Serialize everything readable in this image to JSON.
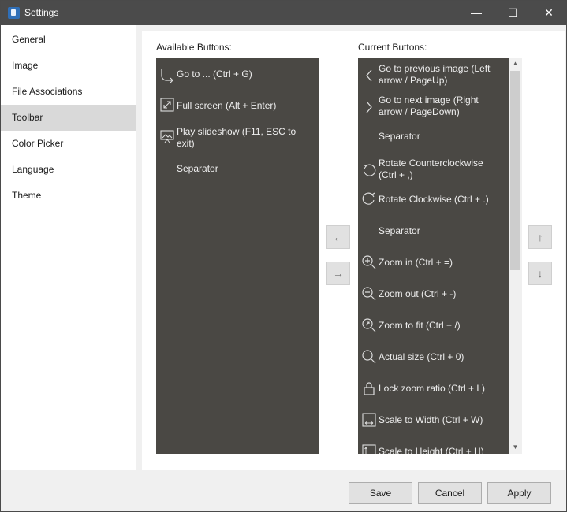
{
  "window": {
    "title": "Settings"
  },
  "titlebar": {
    "minimize": "—",
    "maximize": "☐",
    "close": "✕"
  },
  "sidebar": {
    "items": [
      {
        "label": "General"
      },
      {
        "label": "Image"
      },
      {
        "label": "File Associations"
      },
      {
        "label": "Toolbar",
        "active": true
      },
      {
        "label": "Color Picker"
      },
      {
        "label": "Language"
      },
      {
        "label": "Theme"
      }
    ]
  },
  "available": {
    "label": "Available Buttons:",
    "items": [
      {
        "text": "Go to ... (Ctrl + G)",
        "icon": "goto-icon"
      },
      {
        "text": "Full screen (Alt + Enter)",
        "icon": "fullscreen-icon"
      },
      {
        "text": "Play slideshow (F11, ESC to exit)",
        "icon": "slideshow-icon"
      },
      {
        "text": "Separator",
        "icon": ""
      }
    ]
  },
  "current": {
    "label": "Current Buttons:",
    "items": [
      {
        "text": "Go to previous image (Left arrow / PageUp)",
        "icon": "chevron-left-icon"
      },
      {
        "text": "Go to next image (Right arrow / PageDown)",
        "icon": "chevron-right-icon"
      },
      {
        "text": "Separator",
        "icon": ""
      },
      {
        "text": "Rotate Counterclockwise (Ctrl + ,)",
        "icon": "rotate-ccw-icon"
      },
      {
        "text": "Rotate Clockwise (Ctrl + .)",
        "icon": "rotate-cw-icon"
      },
      {
        "text": "Separator",
        "icon": ""
      },
      {
        "text": "Zoom in (Ctrl + =)",
        "icon": "zoom-in-icon"
      },
      {
        "text": "Zoom out (Ctrl + -)",
        "icon": "zoom-out-icon"
      },
      {
        "text": "Zoom to fit (Ctrl + /)",
        "icon": "zoom-fit-icon"
      },
      {
        "text": "Actual size (Ctrl + 0)",
        "icon": "actual-size-icon"
      },
      {
        "text": "Lock zoom ratio (Ctrl + L)",
        "icon": "lock-icon"
      },
      {
        "text": "Scale to Width (Ctrl + W)",
        "icon": "scale-width-icon"
      },
      {
        "text": "Scale to Height (Ctrl + H)",
        "icon": "scale-height-icon"
      }
    ]
  },
  "move_buttons": {
    "left": "←",
    "right": "→",
    "up": "↑",
    "down": "↓"
  },
  "footer": {
    "save": "Save",
    "cancel": "Cancel",
    "apply": "Apply"
  },
  "colors": {
    "titlebar": "#4b4b4b",
    "list_bg": "#4a4844",
    "sidebar_active": "#d9d9d9"
  }
}
